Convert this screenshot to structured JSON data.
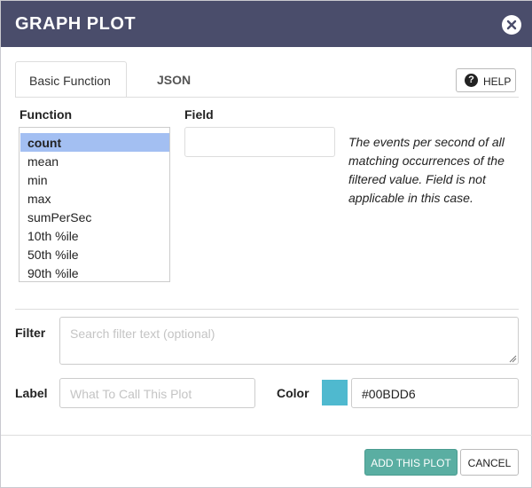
{
  "dialog": {
    "title": "GRAPH PLOT",
    "close_icon": "close-icon"
  },
  "tabs": [
    {
      "label": "Basic Function",
      "active": true
    },
    {
      "label": "JSON",
      "active": false
    }
  ],
  "help": {
    "label": "HELP",
    "icon": "help-icon"
  },
  "function": {
    "label": "Function",
    "items": [
      "count",
      "mean",
      "min",
      "max",
      "sumPerSec",
      "10th %ile",
      "50th %ile",
      "90th %ile"
    ],
    "selected": "count"
  },
  "field": {
    "label": "Field",
    "value": "",
    "description": "The events per second of all matching occurrences of the filtered value. Field is not applicable in this case."
  },
  "filter": {
    "label": "Filter",
    "placeholder": "Search filter text (optional)"
  },
  "plot_label": {
    "label": "Label",
    "placeholder": "What To Call This Plot"
  },
  "color": {
    "label": "Color",
    "value": "#00BDD6",
    "swatch": "#4fb9cf"
  },
  "buttons": {
    "add": "ADD THIS PLOT",
    "cancel": "CANCEL"
  }
}
